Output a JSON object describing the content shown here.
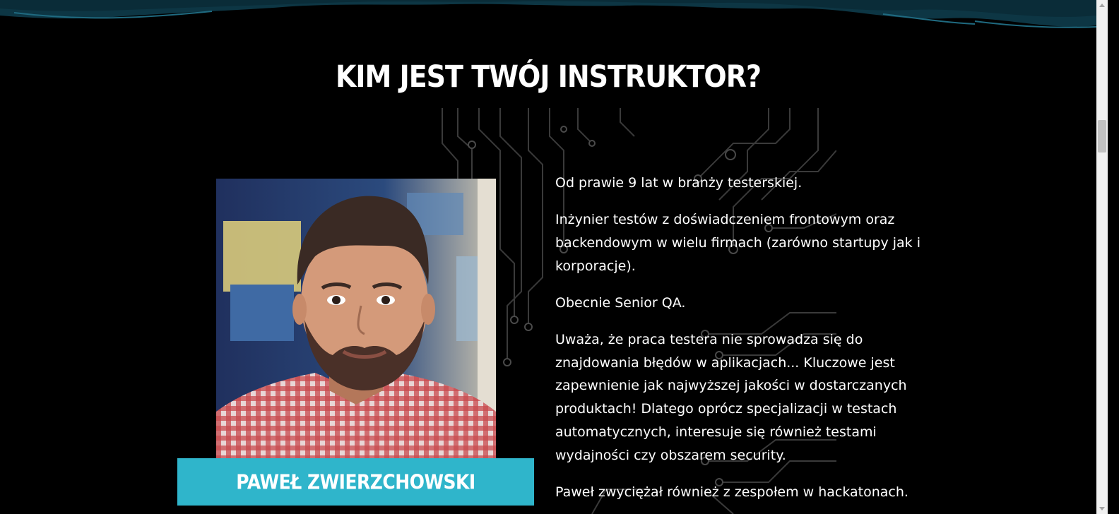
{
  "section": {
    "title": "KIM JEST TWÓJ INSTRUKTOR?"
  },
  "instructor": {
    "name": "PAWEŁ ZWIERZCHOWSKI",
    "photo_icon": "instructor-photo",
    "bio": [
      "Od prawie 9 lat w branży testerskiej.",
      "Inżynier testów z doświadczeniem frontowym oraz backendowym w wielu firmach (zarówno startupy jak i korporacje).",
      "Obecnie Senior QA.",
      "Uważa, że praca testera nie sprowadza się do znajdowania błędów w aplikacjach... Kluczowe jest zapewnienie jak najwyższej jakości w dostarczanych produktach! Dlatego oprócz specjalizacji w testach automatycznych, interesuje się również testami wydajności czy obszarem security.",
      "Paweł zwyciężał również z zespołem w hackatonach."
    ]
  },
  "colors": {
    "background": "#000000",
    "accent": "#2fb5cb",
    "wave": "#0f4150"
  }
}
